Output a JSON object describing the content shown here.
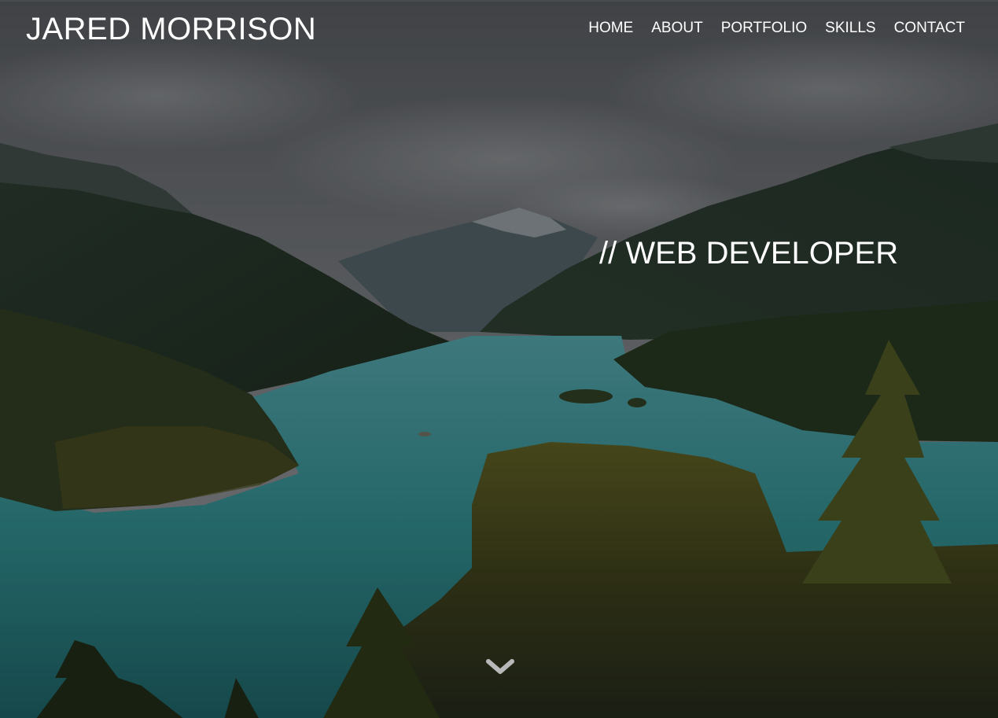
{
  "header": {
    "brand_name": "JARED MORRISON"
  },
  "nav": {
    "items": [
      {
        "label": "HOME"
      },
      {
        "label": "ABOUT"
      },
      {
        "label": "PORTFOLIO"
      },
      {
        "label": "SKILLS"
      },
      {
        "label": "CONTACT"
      }
    ]
  },
  "hero": {
    "tagline": "// WEB DEVELOPER",
    "scroll_icon": "chevron-down-icon"
  },
  "colors": {
    "text": "#ffffff",
    "sky": "#5a5d61",
    "lake": "#2f8a8c",
    "forest": "#2c3b22",
    "overlay": "rgba(0,0,0,0.25)"
  }
}
